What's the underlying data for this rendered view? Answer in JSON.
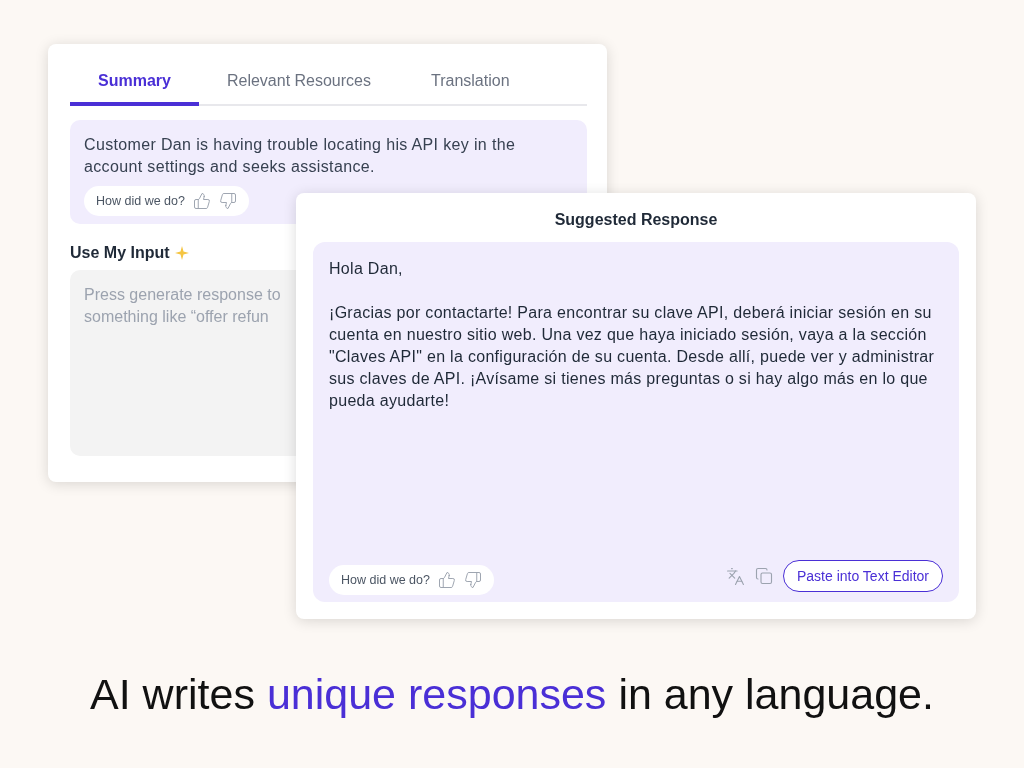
{
  "summary_card": {
    "tabs": [
      {
        "label": "Summary",
        "selected": true
      },
      {
        "label": "Relevant Resources",
        "selected": false
      },
      {
        "label": "Translation",
        "selected": false
      }
    ],
    "summary": "Customer Dan is having trouble locating his API key in the account settings and seeks assistance.",
    "feedback": {
      "prompt": "How did we do?"
    },
    "input_label": "Use My Input",
    "input_placeholder": "Press generate response to\nsomething like “offer refun"
  },
  "response_card": {
    "title": "Suggested Response",
    "greeting": "Hola Dan,",
    "body": "¡Gracias por contactarte! Para encontrar su clave API, deberá iniciar sesión en su cuenta en nuestro sitio web. Una vez que haya iniciado sesión, vaya a la sección \"Claves API\" en la configuración de su cuenta. Desde allí, puede ver y administrar sus claves de API. ¡Avísame si tienes más preguntas o si hay algo más en lo que pueda ayudarte!",
    "feedback": {
      "prompt": "How did we do?"
    },
    "paste_button": "Paste into Text Editor"
  },
  "headline": [
    {
      "text": "AI writes",
      "highlight": false
    },
    {
      "text": "unique responses",
      "highlight": true
    },
    {
      "text": "in any language.",
      "highlight": false
    }
  ]
}
